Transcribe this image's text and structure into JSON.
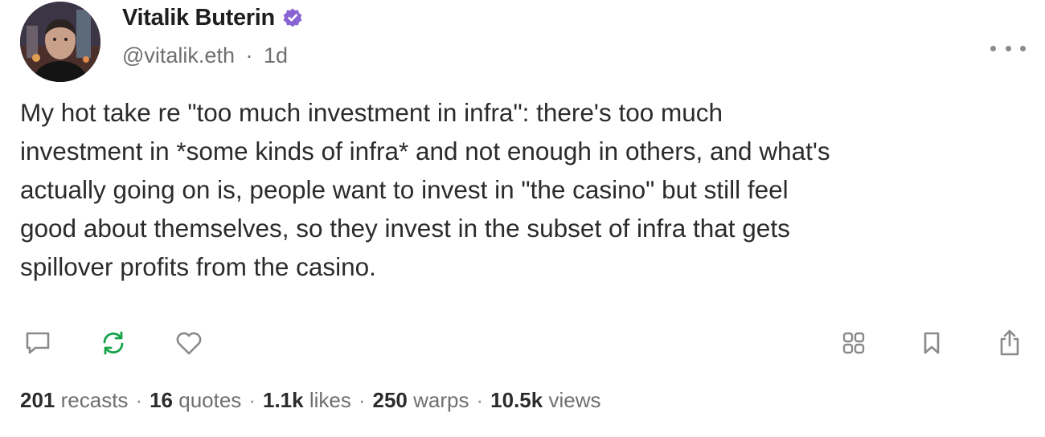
{
  "author": {
    "name": "Vitalik Buterin",
    "handle": "@vitalik.eth",
    "separator": "·",
    "time": "1d"
  },
  "cast": {
    "text": "My hot take re \"too much investment in infra\": there's too much\ninvestment in *some kinds of infra* and not enough in others, and what's\nactually going on is, people want to invest in \"the casino\" but still feel\ngood about themselves, so they invest in the subset of infra that gets\nspillover profits from the casino."
  },
  "stats": {
    "recasts_count": "201",
    "recasts_label": " recasts",
    "quotes_count": "16",
    "quotes_label": " quotes",
    "likes_count": "1.1k",
    "likes_label": " likes",
    "warps_count": "250",
    "warps_label": " warps",
    "views_count": "10.5k",
    "views_label": " views",
    "separator": "·"
  },
  "icons": {
    "verified": "verified-badge-icon",
    "reply": "comment-icon",
    "recast": "recast-icon",
    "like": "heart-icon",
    "channels": "grid-icon",
    "bookmark": "bookmark-icon",
    "share": "share-icon",
    "more": "more-dots-icon"
  },
  "colors": {
    "verified": "#8a63d2",
    "recast_active": "#16a34a",
    "icon_default": "#8a8a8a"
  }
}
